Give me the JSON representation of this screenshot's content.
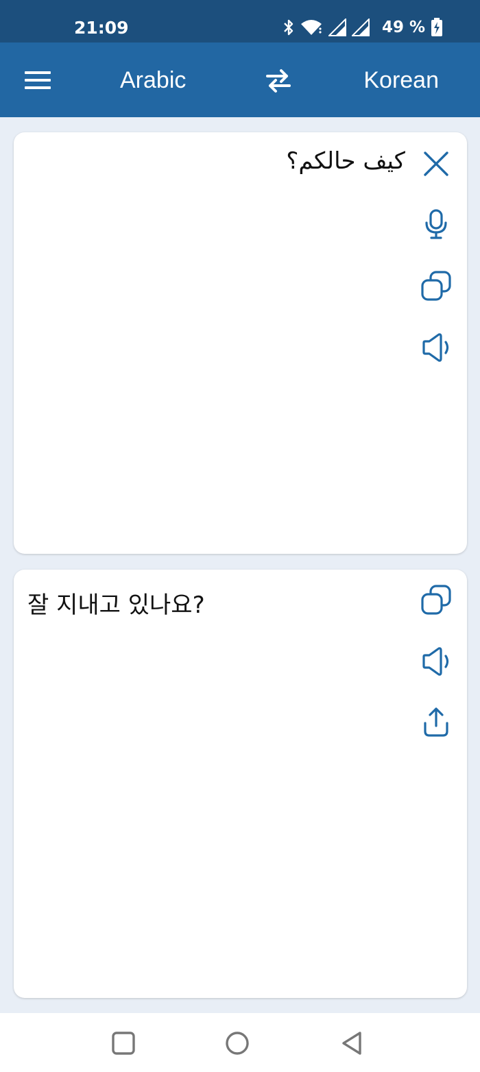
{
  "status_bar": {
    "time": "21:09",
    "battery": "49 %",
    "icons": [
      "bluetooth-icon",
      "wifi-icon",
      "signal-icon",
      "signal-icon",
      "battery-charging-icon"
    ]
  },
  "app_bar": {
    "source_language": "Arabic",
    "target_language": "Korean",
    "menu_icon": "hamburger-menu-icon",
    "swap_icon": "swap-arrows-icon",
    "background": "#2267a3"
  },
  "source_card": {
    "text": "كيف حالكم؟",
    "actions": [
      "close-icon",
      "microphone-icon",
      "copy-icon",
      "speaker-icon"
    ]
  },
  "target_card": {
    "text": "잘 지내고 있나요?",
    "actions": [
      "copy-icon",
      "speaker-icon",
      "share-icon"
    ]
  },
  "nav_bar": {
    "buttons": [
      "recents-square-icon",
      "home-circle-icon",
      "back-triangle-icon"
    ]
  },
  "colors": {
    "accent": "#2267a3",
    "status_bar": "#1c4f7d",
    "background": "#e8eef6",
    "icon": "#1f6aa8"
  }
}
